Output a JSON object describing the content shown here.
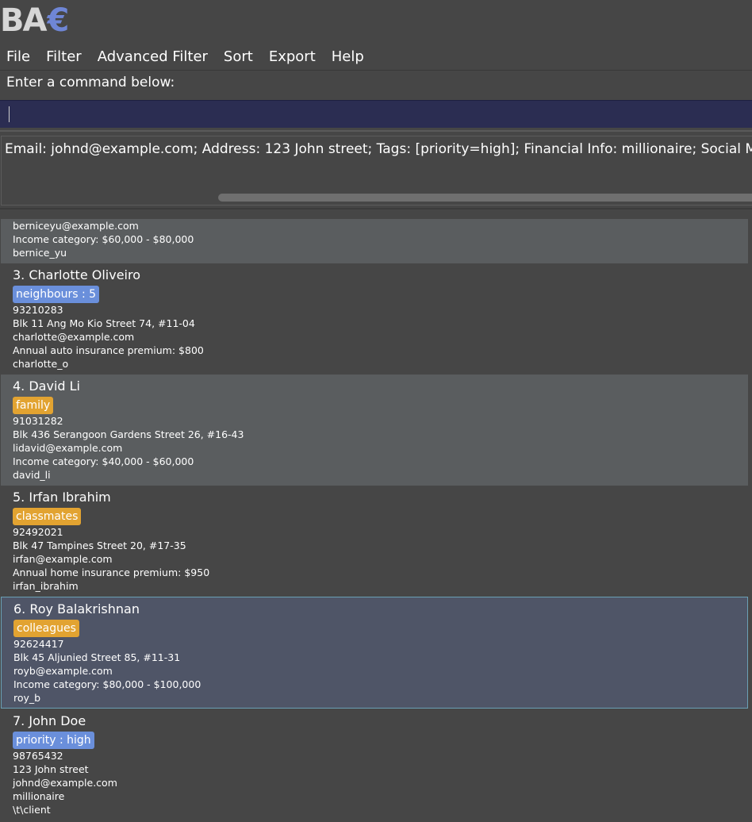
{
  "logo": {
    "text_main": "BA",
    "text_symbol": "€"
  },
  "menu": [
    "File",
    "Filter",
    "Advanced Filter",
    "Sort",
    "Export",
    "Help"
  ],
  "command": {
    "label": "Enter a command below:",
    "value": ""
  },
  "result": {
    "text": "Email: johnd@example.com; Address: 123 John street; Tags: [priority=high]; Financial Info: millionaire; Social Media Handle: \\t\\client"
  },
  "partial_card": {
    "email": "berniceyu@example.com",
    "financial": "Income category: $60,000 - $80,000",
    "social": "bernice_yu"
  },
  "persons": [
    {
      "name": "3. Charlotte Oliveiro",
      "tag": "neighbours : 5",
      "tag_color": "#6a8fdb",
      "phone": "93210283",
      "address": "Blk 11 Ang Mo Kio Street 74, #11-04",
      "email": "charlotte@example.com",
      "financial": "Annual auto insurance premium: $800",
      "social": "charlotte_o"
    },
    {
      "name": "4. David Li",
      "tag": "family",
      "tag_color": "#e2a331",
      "phone": "91031282",
      "address": "Blk 436 Serangoon Gardens Street 26, #16-43",
      "email": "lidavid@example.com",
      "financial": "Income category: $40,000 - $60,000",
      "social": "david_li"
    },
    {
      "name": "5. Irfan Ibrahim",
      "tag": "classmates",
      "tag_color": "#e2a331",
      "phone": "92492021",
      "address": "Blk 47 Tampines Street 20, #17-35",
      "email": "irfan@example.com",
      "financial": "Annual home insurance premium: $950",
      "social": "irfan_ibrahim"
    },
    {
      "name": "6. Roy Balakrishnan",
      "tag": "colleagues",
      "tag_color": "#e2a331",
      "phone": "92624417",
      "address": "Blk 45 Aljunied Street 85, #11-31",
      "email": "royb@example.com",
      "financial": "Income category: $80,000 - $100,000",
      "social": "roy_b"
    },
    {
      "name": "7. John Doe",
      "tag": "priority : high",
      "tag_color": "#6a8fdb",
      "phone": "98765432",
      "address": "123 John street",
      "email": "johnd@example.com",
      "financial": "millionaire",
      "social": "\\t\\client"
    }
  ]
}
